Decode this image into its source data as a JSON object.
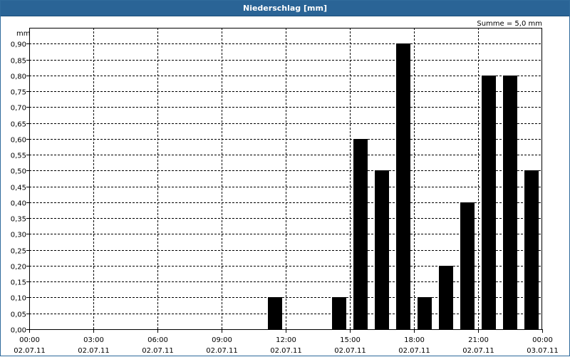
{
  "window": {
    "title": "Niederschlag [mm]"
  },
  "chart_data": {
    "type": "bar",
    "title": "Niederschlag [mm]",
    "ylabel": "mm",
    "annotation": "Summe = 5,0 mm",
    "ylim": [
      0,
      0.95
    ],
    "yticks": [
      "0,00",
      "0,05",
      "0,10",
      "0,15",
      "0,20",
      "0,25",
      "0,30",
      "0,35",
      "0,40",
      "0,45",
      "0,50",
      "0,55",
      "0,60",
      "0,65",
      "0,70",
      "0,75",
      "0,80",
      "0,85",
      "0,90"
    ],
    "xlim_hours": [
      0,
      24
    ],
    "xticks": [
      {
        "time": "00:00",
        "date": "02.07.11"
      },
      {
        "time": "03:00",
        "date": "02.07.11"
      },
      {
        "time": "06:00",
        "date": "02.07.11"
      },
      {
        "time": "09:00",
        "date": "02.07.11"
      },
      {
        "time": "12:00",
        "date": "02.07.11"
      },
      {
        "time": "15:00",
        "date": "02.07.11"
      },
      {
        "time": "18:00",
        "date": "02.07.11"
      },
      {
        "time": "21:00",
        "date": "02.07.11"
      },
      {
        "time": "00:00",
        "date": "03.07.11"
      }
    ],
    "grid": true,
    "bar_color": "#000000",
    "categories": [
      "00:00",
      "01:00",
      "02:00",
      "03:00",
      "04:00",
      "05:00",
      "06:00",
      "07:00",
      "08:00",
      "09:00",
      "10:00",
      "11:00",
      "12:00",
      "13:00",
      "14:00",
      "15:00",
      "16:00",
      "17:00",
      "18:00",
      "19:00",
      "20:00",
      "21:00",
      "22:00",
      "23:00"
    ],
    "values": [
      0,
      0,
      0,
      0,
      0,
      0,
      0,
      0,
      0,
      0,
      0,
      0.1,
      0,
      0,
      0.1,
      0.6,
      0.5,
      0.9,
      0.1,
      0.2,
      0.4,
      0.8,
      0.8,
      0.5
    ]
  }
}
